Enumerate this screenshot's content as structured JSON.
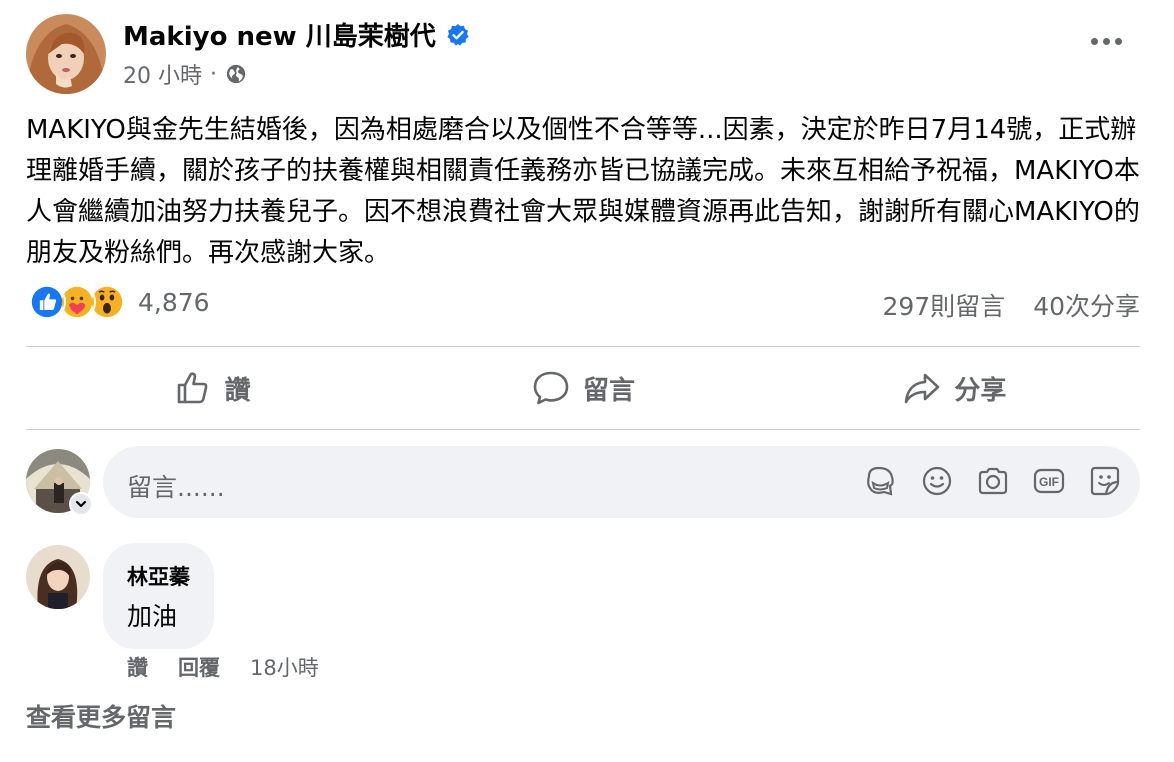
{
  "post": {
    "author": "Makiyo new 川島茉樹代",
    "time": "20 小時",
    "separator": "·",
    "text": "MAKIYO與金先生結婚後，因為相處磨合以及個性不合等等...因素，決定於昨日7月14號，正式辦理離婚手續，關於孩子的扶養權與相關責任義務亦皆已協議完成。未來互相給予祝福，MAKIYO本人會繼續加油努力扶養兒子。因不想浪費社會大眾與媒體資源再此告知，謝謝所有關心MAKIYO的朋友及粉絲們。再次感謝大家。"
  },
  "reactions": {
    "count": "4,876",
    "icons": [
      "like-icon",
      "care-icon",
      "wow-icon"
    ]
  },
  "stats": {
    "comments": "297則留言",
    "shares": "40次分享"
  },
  "actions": {
    "like": "讚",
    "comment": "留言",
    "share": "分享"
  },
  "composer": {
    "placeholder": "留言......"
  },
  "comments": [
    {
      "name": "林亞蓁",
      "text": "加油",
      "like": "讚",
      "reply": "回覆",
      "time": "18小時"
    }
  ],
  "view_more": "查看更多留言",
  "colors": {
    "accent": "#1877f2",
    "secondary_text": "#65676b",
    "bubble_bg": "#f0f2f5"
  }
}
